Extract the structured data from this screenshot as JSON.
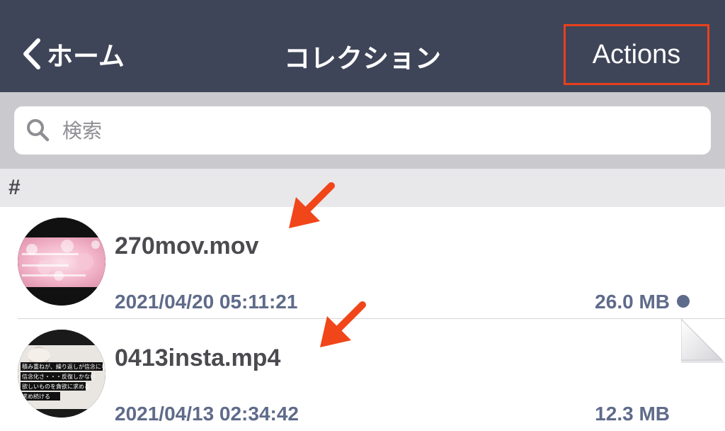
{
  "navbar": {
    "back_label": "ホーム",
    "title": "コレクション",
    "actions_label": "Actions",
    "background": "#3f4558",
    "highlight_color": "#e8401c"
  },
  "search": {
    "placeholder": "検索",
    "icon": "search-icon"
  },
  "section": {
    "header": "#"
  },
  "files": [
    {
      "name": "270mov.mov",
      "date": "2021/04/20 05:11:21",
      "size": "26.0 MB",
      "status": "dot"
    },
    {
      "name": "0413insta.mp4",
      "date": "2021/04/13 02:34:42",
      "size": "12.3 MB",
      "thumb_lines": [
        "積み重ねが、繰り返しが信念になる",
        "信念化さ・・・反復しかない",
        "欲しいものを貪欲に求める",
        "求め続ける"
      ]
    }
  ],
  "annotations": {
    "arrow_color": "#f0461a"
  }
}
